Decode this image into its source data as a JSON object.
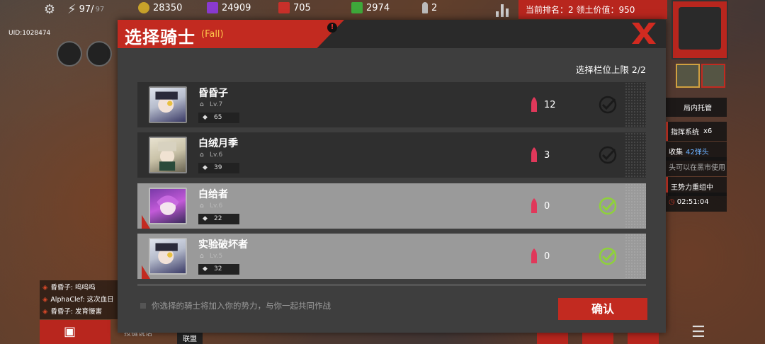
{
  "topbar": {
    "energy": "97/",
    "energy_max": "97",
    "gold": "28350",
    "crystal": "24909",
    "ore": "705",
    "green": "2974",
    "ammo": "2",
    "rank_text": "当前排名：2  领土价值：950"
  },
  "uid": "UID:1028474",
  "side_panels": {
    "managed": "局内托管",
    "command": "指挥系统",
    "command_count": "x6",
    "collect": "收集",
    "collect_ammo": "42弹头",
    "market": "头可以在黑市使用",
    "regroup": "王势力重组中",
    "timer": "02:51:04"
  },
  "chat": {
    "lines": [
      "昏昏子: 呜呜呜",
      "AlphaClef: 这次血日",
      "昏昏子: 发育慢害"
    ],
    "talk_label": "按键说话",
    "union_label": "联盟"
  },
  "modal": {
    "title": "选择骑士",
    "subtitle": "(Fall)",
    "limit": "选择栏位上限 2/2",
    "knights": [
      {
        "name": "昏昏子",
        "level": "Lv.7",
        "power": "65",
        "ammo": "12",
        "selected": false
      },
      {
        "name": "白绒月季",
        "level": "Lv.6",
        "power": "39",
        "ammo": "3",
        "selected": false
      },
      {
        "name": "白给者",
        "level": "Lv.6",
        "power": "22",
        "ammo": "0",
        "selected": true
      },
      {
        "name": "实验破坏者",
        "level": "Lv.5",
        "power": "32",
        "ammo": "0",
        "selected": true
      }
    ],
    "footer_text": "你选择的骑士将加入你的势力，与你一起共同作战",
    "confirm_label": "确认"
  },
  "colors": {
    "accent_red": "#c22a20",
    "check_green": "#8fd13b",
    "subtitle_yellow": "#ffc64a"
  }
}
